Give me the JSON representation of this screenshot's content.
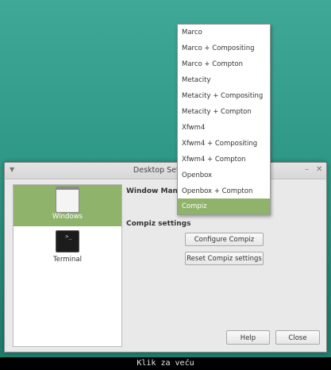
{
  "window": {
    "title": "Desktop Settings",
    "sidebar": [
      {
        "label": "Windows",
        "icon": "windows-icon",
        "selected": true
      },
      {
        "label": "Terminal",
        "icon": "terminal-icon",
        "selected": false
      }
    ],
    "window_manager_label": "Window Manager",
    "compiz_settings_label": "Compiz settings",
    "buttons": {
      "configure": "Configure Compiz",
      "reset": "Reset Compiz settings",
      "help": "Help",
      "close": "Close"
    }
  },
  "dropdown": {
    "items": [
      "Marco",
      "Marco + Compositing",
      "Marco + Compton",
      "Metacity",
      "Metacity + Compositing",
      "Metacity + Compton",
      "Xfwm4",
      "Xfwm4 + Compositing",
      "Xfwm4 + Compton",
      "Openbox",
      "Openbox + Compton",
      "Compiz"
    ],
    "selected": "Compiz"
  },
  "caption": "Klik za veću",
  "colors": {
    "desktop": "#2f9886",
    "selection": "#8fb36b"
  }
}
